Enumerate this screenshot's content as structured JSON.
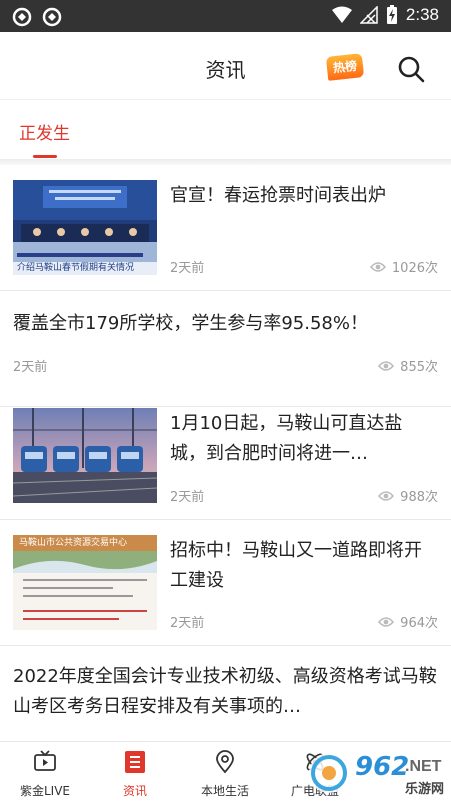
{
  "status_bar": {
    "time": "2:38"
  },
  "header": {
    "title": "资讯",
    "hot_badge": "热榜"
  },
  "tabs": [
    {
      "label": "正发生",
      "active": true
    }
  ],
  "news": [
    {
      "headline": "官宣！春运抢票时间表出炉",
      "time": "2天前",
      "views": "1026次",
      "thumb_caption": "介绍马鞍山春节假期有关情况"
    },
    {
      "headline": "覆盖全市179所学校，学生参与率95.58%！",
      "time": "2天前",
      "views": "855次"
    },
    {
      "headline": "1月10日起，马鞍山可直达盐城，到合肥时间将进一…",
      "time": "2天前",
      "views": "988次"
    },
    {
      "headline": "招标中！马鞍山又一道路即将开工建设",
      "time": "2天前",
      "views": "964次",
      "thumb_caption": "马鞍山市公共资源交易中心"
    },
    {
      "headline": "2022年度全国会计专业技术初级、高级资格考试马鞍山考区考务日程安排及有关事项的…"
    }
  ],
  "bottom_nav": [
    {
      "label": "紫金LIVE",
      "icon": "tv-icon"
    },
    {
      "label": "资讯",
      "icon": "list-icon",
      "active": true
    },
    {
      "label": "本地生活",
      "icon": "location-icon"
    },
    {
      "label": "广电联盟",
      "icon": "alliance-icon"
    }
  ],
  "watermark": {
    "text": "962",
    "suffix": ".NET",
    "site": "乐游网"
  }
}
